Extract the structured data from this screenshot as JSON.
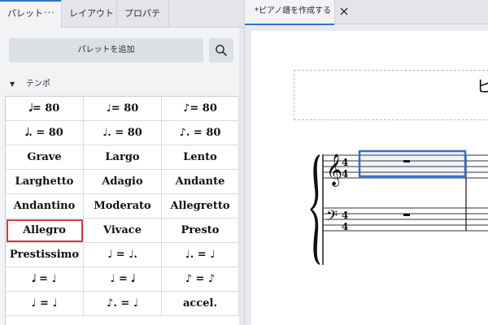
{
  "left_panel": {
    "tabs": [
      {
        "label": "パレット"
      },
      {
        "label": "レイアウト"
      },
      {
        "label": "プロパティ"
      }
    ],
    "tab_more": "···",
    "add_palette_label": "パレットを追加",
    "search_icon": "search-icon",
    "section": {
      "chevron": "▼",
      "label": "テンポ"
    },
    "grid": {
      "selected": "Allegro",
      "cells": [
        "𝅗𝅥= 80",
        "♩= 80",
        "♪= 80",
        "𝅗𝅥. = 80",
        "♩. = 80",
        "♪. = 80",
        "Grave",
        "Largo",
        "Lento",
        "Larghetto",
        "Adagio",
        "Andante",
        "Andantino",
        "Moderato",
        "Allegretto",
        "Allegro",
        "Vivace",
        "Presto",
        "Prestissimo",
        "♩ = ♩.",
        "♩. = ♩",
        "𝅗𝅥 = ♩",
        "♩ = 𝅗𝅥",
        "♪ = ♪",
        "♩ = ♩",
        "♪. = ♩",
        "accel."
      ]
    }
  },
  "document": {
    "tab_label": "*ピアノ譜を作成する",
    "close_icon": "close-icon",
    "score_title": "ピア",
    "accent_color": "#2f73c9",
    "selection_color": "#d23a3a"
  }
}
